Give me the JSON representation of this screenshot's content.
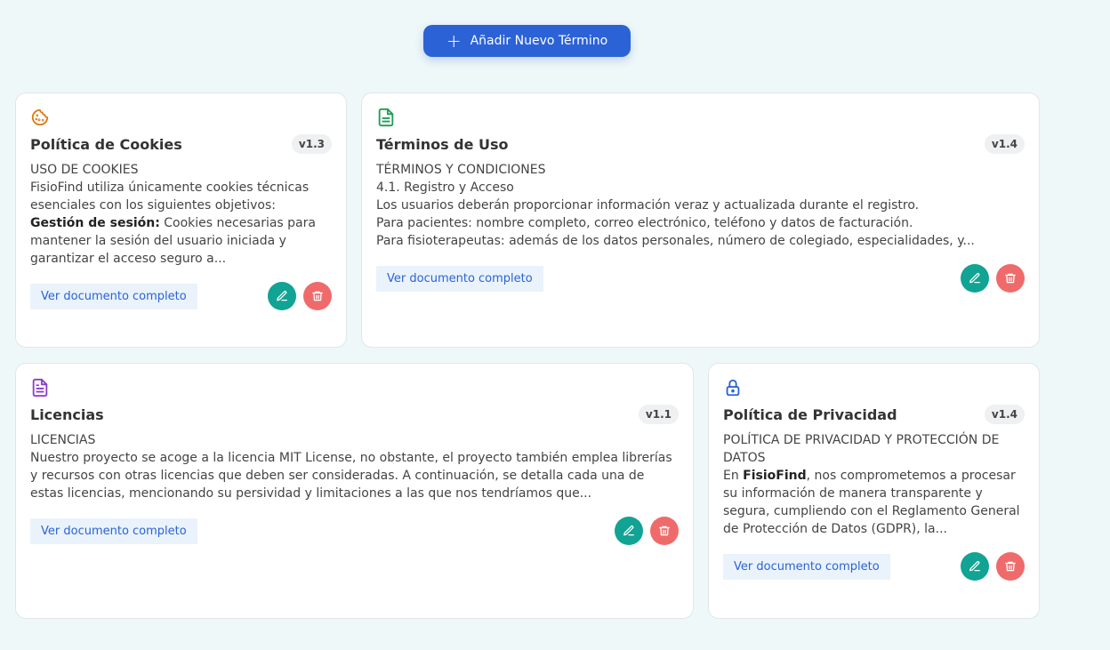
{
  "add_button": {
    "label": "Añadir Nuevo Término"
  },
  "cards": [
    {
      "title": "Política de Cookies",
      "version": "v1.3",
      "icon": "cookie-icon",
      "lines": [
        "USO DE COOKIES",
        "FisioFind utiliza únicamente cookies técnicas esenciales con los siguientes objetivos:"
      ],
      "bold_lead": "Gestión de sesión:",
      "bold_rest": "Cookies necesarias para mantener la sesión del usuario iniciada y garantizar el acceso seguro a...",
      "view_label": "Ver documento completo"
    },
    {
      "title": "Términos de Uso",
      "version": "v1.4",
      "icon": "document-icon",
      "lines": [
        "TÉRMINOS Y CONDICIONES",
        "4.1. Registro y Acceso",
        "Los usuarios deberán proporcionar información veraz y actualizada durante el registro.",
        "Para pacientes: nombre completo, correo electrónico, teléfono y datos de facturación.",
        "Para fisioterapeutas: además de los datos personales, número de colegiado, especialidades, y..."
      ],
      "view_label": "Ver documento completo"
    },
    {
      "title": "Licencias",
      "version": "v1.1",
      "icon": "license-document-icon",
      "lines": [
        "LICENCIAS",
        "Nuestro proyecto se acoge a la licencia MIT License, no obstante, el proyecto también emplea librerías y recursos con otras licencias que deben ser consideradas. A continuación, se detalla cada una de estas licencias, mencionando su persividad y limitaciones a las que nos tendríamos que..."
      ],
      "view_label": "Ver documento completo"
    },
    {
      "title": "Política de Privacidad",
      "version": "v1.4",
      "icon": "lock-icon",
      "lines": [
        "POLÍTICA DE PRIVACIDAD Y PROTECCIÓN DE DATOS"
      ],
      "pre": "En ",
      "bold_word": "FisioFind",
      "post": ", nos comprometemos a procesar su información de manera transparente y segura, cumpliendo con el Reglamento General de Protección de Datos (GDPR), la...",
      "view_label": "Ver documento completo"
    }
  ],
  "colors": {
    "primary": "#2b62d6",
    "edit": "#11a394",
    "delete": "#ef6b6b",
    "cookie_icon": "#d97a14",
    "doc_icon": "#1e9b57",
    "license_icon": "#8a3fc9",
    "lock_icon": "#2b62d6"
  }
}
